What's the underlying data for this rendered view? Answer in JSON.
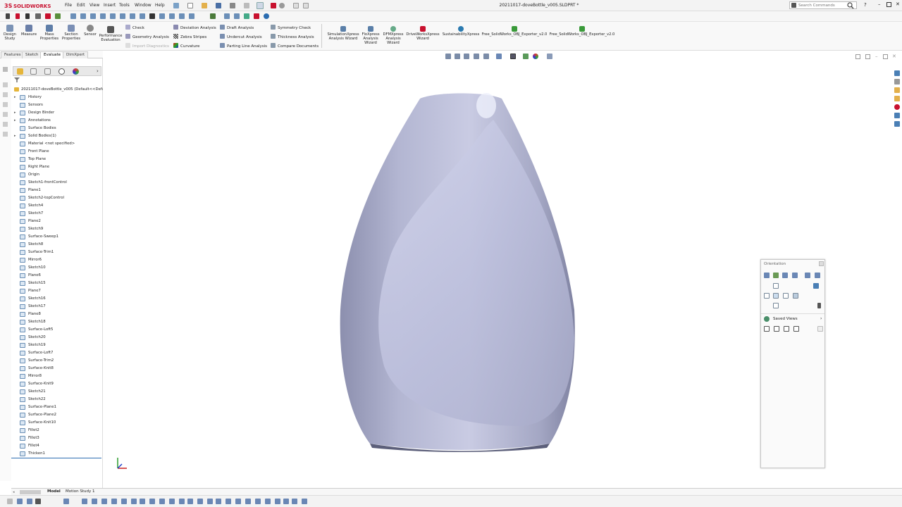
{
  "app": {
    "brand": "SOLIDWORKS",
    "document_title": "20211017-doveBottle_v005.SLDPRT *"
  },
  "menus": [
    "File",
    "Edit",
    "View",
    "Insert",
    "Tools",
    "Window",
    "Help"
  ],
  "search": {
    "placeholder": "Search Commands"
  },
  "ribbon": {
    "big_buttons": [
      {
        "label": "Design\nStudy"
      },
      {
        "label": "Measure"
      },
      {
        "label": "Mass\nProperties"
      },
      {
        "label": "Section\nProperties"
      },
      {
        "label": "Sensor"
      },
      {
        "label": "Performance\nEvaluation"
      }
    ],
    "col1": [
      "Check",
      "Geometry Analysis",
      "Import Diagnostics"
    ],
    "col2": [
      "Deviation Analysis",
      "Zebra Stripes",
      "Curvature"
    ],
    "col3": [
      "Draft Analysis",
      "Undercut Analysis",
      "Parting Line Analysis"
    ],
    "col4": [
      "Symmetry Check",
      "Thickness Analysis",
      "Compare Documents"
    ],
    "addins": [
      {
        "label": "SimulationXpress\nAnalysis Wizard"
      },
      {
        "label": "FloXpress\nAnalysis\nWizard"
      },
      {
        "label": "DFMXpress\nAnalysis\nWizard"
      },
      {
        "label": "DriveWorksXpress\nWizard"
      },
      {
        "label": "SustainabilityXpress"
      },
      {
        "label": "Free_SolidWorks_OBJ_Exporter_v2.0"
      },
      {
        "label": "Free_SolidWorks_OBJ_Exporter_v2.0"
      }
    ]
  },
  "tabs": [
    "Features",
    "Sketch",
    "Evaluate",
    "DimXpert"
  ],
  "tree": {
    "root": "20211017-doveBottle_v005  (Default<<Defa",
    "items": [
      "History",
      "Sensors",
      "Design Binder",
      "Annotations",
      "Surface Bodies",
      "Solid Bodies(1)",
      "Material <not specified>",
      "Front Plane",
      "Top Plane",
      "Right Plane",
      "Origin",
      "Sketch1-frontControl",
      "Plane1",
      "Sketch2-topControl",
      "Sketch4",
      "Sketch7",
      "Plane2",
      "Sketch9",
      "Surface-Sweep1",
      "Sketch8",
      "Surface-Trim1",
      "Mirror6",
      "Sketch10",
      "Plane6",
      "Sketch15",
      "Plane7",
      "Sketch16",
      "Sketch17",
      "Plane8",
      "Sketch18",
      "Surface-Loft5",
      "Sketch20",
      "Sketch19",
      "Surface-Loft7",
      "Surface-Trim2",
      "Surface-Knit8",
      "Mirror8",
      "Surface-Knit9",
      "Sketch21",
      "Sketch22",
      "Surface-Plane1",
      "Surface-Plane2",
      "Surface-Knit10",
      "Fillet2",
      "Fillet3",
      "Fillet4",
      "Thicken1"
    ]
  },
  "orientation": {
    "title": "Orientation",
    "saved_views": "Saved Views"
  },
  "bottom_tabs": [
    "Model",
    "Motion Study 1"
  ],
  "colors": {
    "accent": "#c8102e",
    "body": "#a9adc9"
  }
}
